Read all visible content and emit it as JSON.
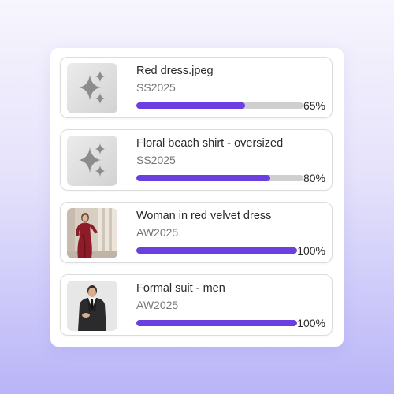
{
  "uploads": [
    {
      "title": "Red dress.jpeg",
      "season": "SS2025",
      "progress": 65,
      "progress_label": "65%",
      "thumbnail": "sparkle-placeholder-icon"
    },
    {
      "title": "Floral beach shirt - oversized",
      "season": "SS2025",
      "progress": 80,
      "progress_label": "80%",
      "thumbnail": "sparkle-placeholder-icon"
    },
    {
      "title": "Woman in red velvet dress",
      "season": "AW2025",
      "progress": 100,
      "progress_label": "100%",
      "thumbnail": "woman-red-dress-photo"
    },
    {
      "title": "Formal suit - men",
      "season": "AW2025",
      "progress": 100,
      "progress_label": "100%",
      "thumbnail": "man-suit-photo"
    }
  ],
  "colors": {
    "progress_fill": "#6b3fe0",
    "progress_track": "#cfcfcf"
  }
}
